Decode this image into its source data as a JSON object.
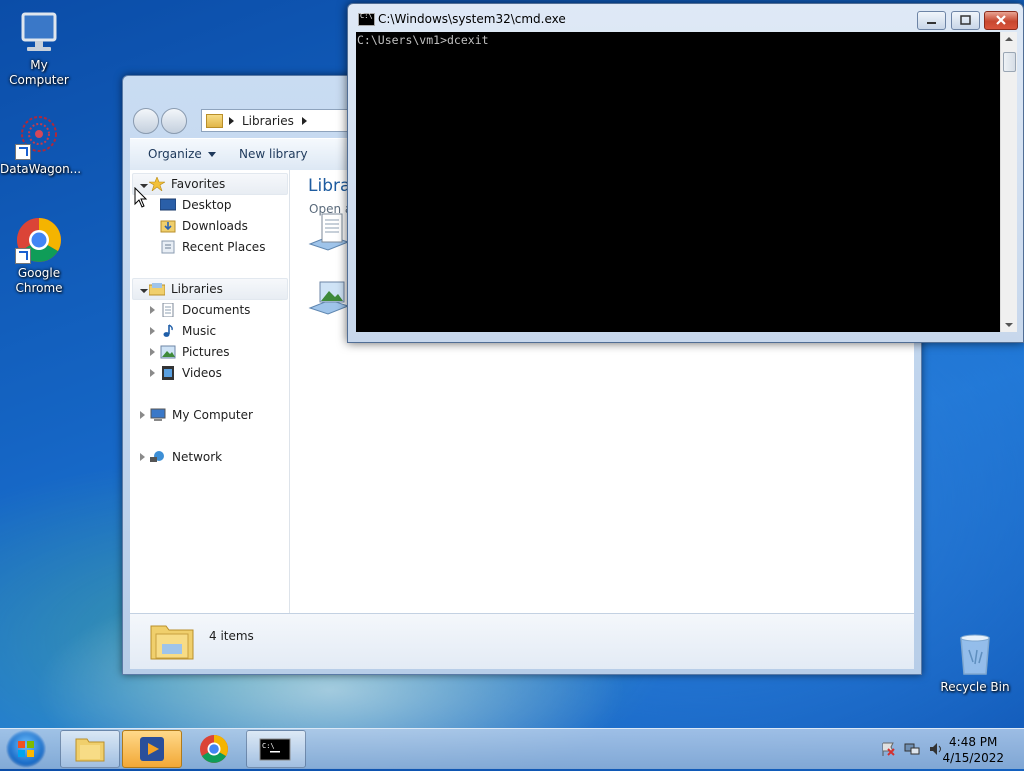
{
  "desktop": {
    "icons": [
      {
        "label": "My Computer",
        "icon": "computer-icon"
      },
      {
        "label": "DataWagon...",
        "icon": "datawagon-icon"
      },
      {
        "label": "Google Chrome",
        "icon": "chrome-icon"
      },
      {
        "label": "Recycle Bin",
        "icon": "recycle-bin-icon"
      }
    ]
  },
  "explorer": {
    "address": {
      "crumb": "Libraries"
    },
    "toolbar": {
      "organize": "Organize",
      "new_library": "New library"
    },
    "nav": {
      "favorites": "Favorites",
      "desktop": "Desktop",
      "downloads": "Downloads",
      "recent": "Recent Places",
      "libraries": "Libraries",
      "documents": "Documents",
      "music": "Music",
      "pictures": "Pictures",
      "videos": "Videos",
      "my_computer": "My Computer",
      "network": "Network"
    },
    "content": {
      "title": "Libra",
      "subtitle": "Open a"
    },
    "status": {
      "count": "4 items"
    }
  },
  "cmd": {
    "title": "C:\\Windows\\system32\\cmd.exe",
    "line": "C:\\Users\\vm1>dcexit"
  },
  "taskbar": {
    "time": "4:48 PM",
    "date": "4/15/2022",
    "buttons": [
      "windows-explorer",
      "media-player",
      "google-chrome",
      "command-prompt"
    ]
  },
  "colors": {
    "accent": "#1e5ca0",
    "cmd_bg": "#000000",
    "cmd_fg": "#c0c0c0"
  }
}
